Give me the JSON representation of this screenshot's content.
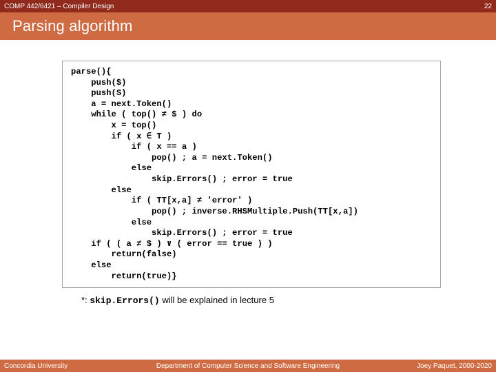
{
  "header": {
    "course": "COMP 442/6421 – Compiler Design",
    "page_number": "22"
  },
  "title": "Parsing algorithm",
  "code": "parse(){\n    push($)\n    push(S)\n    a = next.Token()\n    while ( top() ≠ $ ) do\n        x = top()\n        if ( x ∈ T )\n            if ( x == a )\n                pop() ; a = next.Token()\n            else\n                skip.Errors() ; error = true\n        else\n            if ( TT[x,a] ≠ 'error' )\n                pop() ; inverse.RHSMultiple.Push(TT[x,a])\n            else\n                skip.Errors() ; error = true\n    if ( ( a ≠ $ ) ∨ ( error == true ) )\n        return(false)\n    else\n        return(true)}",
  "note": {
    "prefix": "*: ",
    "fn": "skip.Errors()",
    "suffix": "  will be explained in lecture 5"
  },
  "footer": {
    "left": "Concordia University",
    "center": "Department of Computer Science and Software Engineering",
    "right": "Joey Paquet, 2000-2020"
  }
}
